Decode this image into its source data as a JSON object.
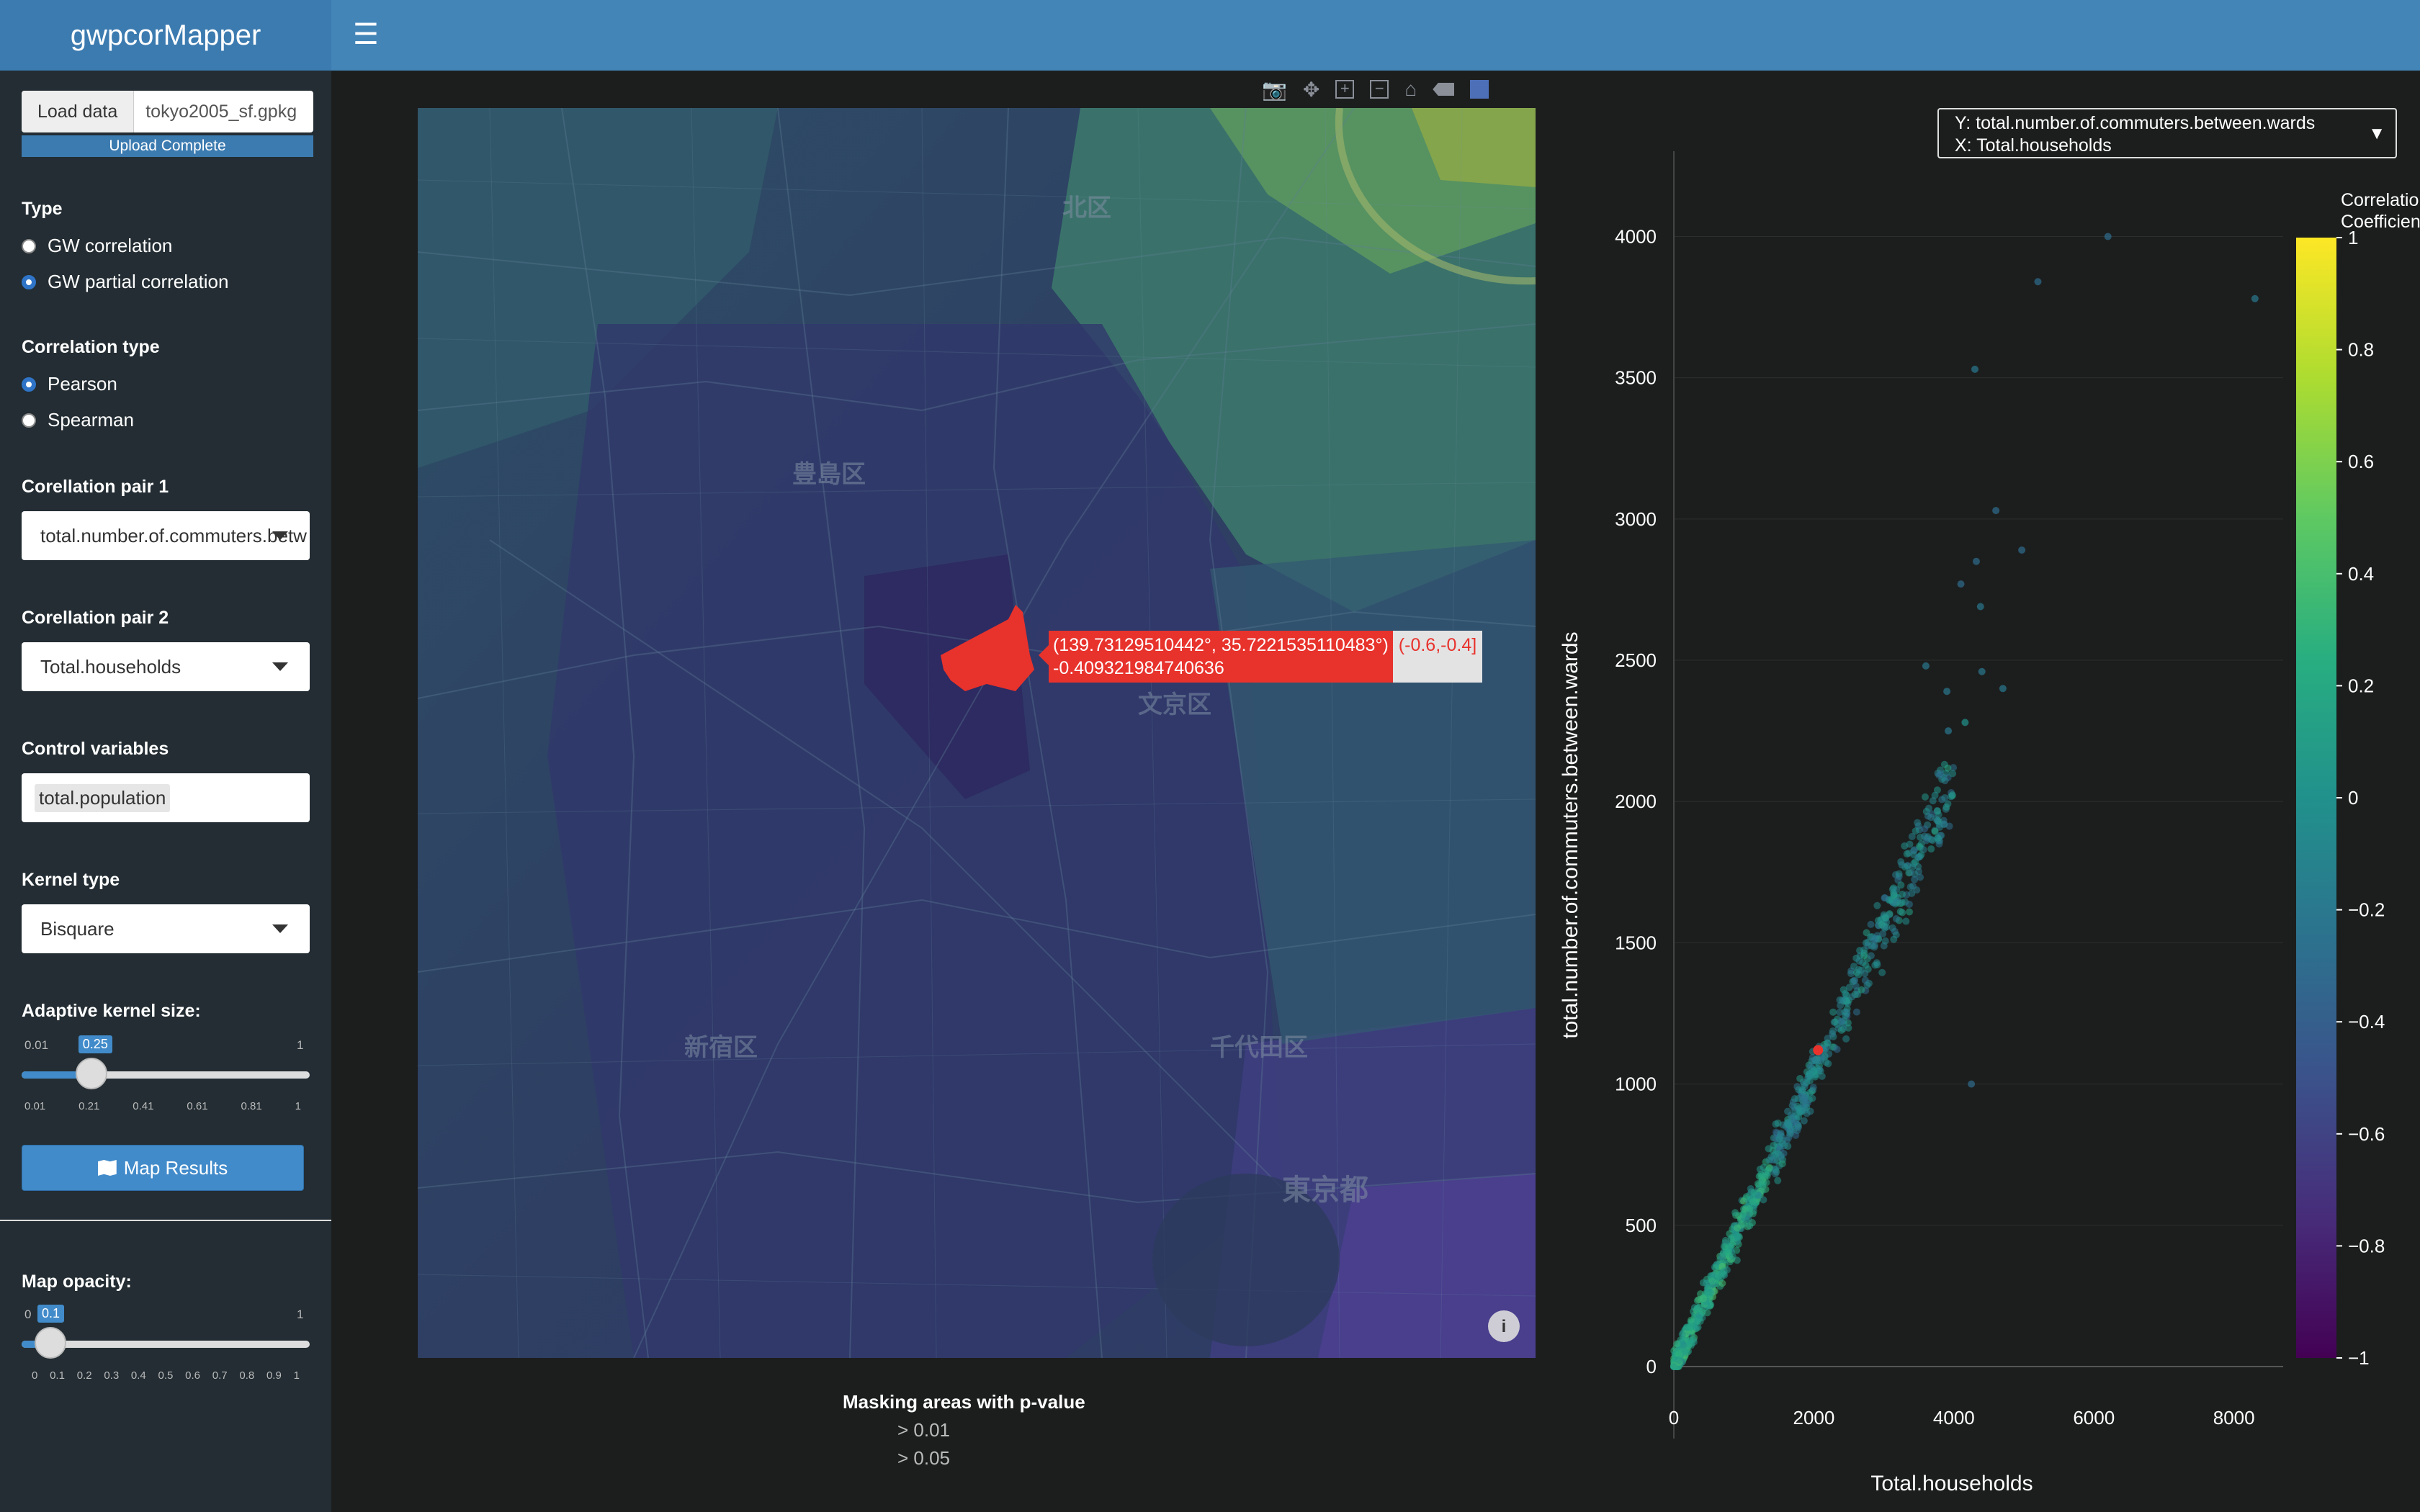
{
  "app": {
    "title": "gwpcorMapper"
  },
  "sidebar": {
    "load_data_button": "Load data",
    "file_name": "tokyo2005_sf.gpkg",
    "upload_status": "Upload Complete",
    "type": {
      "label": "Type",
      "options": [
        "GW correlation",
        "GW partial correlation"
      ],
      "selected": "GW partial correlation"
    },
    "correlation_type": {
      "label": "Correlation type",
      "options": [
        "Pearson",
        "Spearman"
      ],
      "selected": "Pearson"
    },
    "pair1": {
      "label": "Corellation pair 1",
      "value": "total.number.of.commuters.betw"
    },
    "pair2": {
      "label": "Corellation pair 2",
      "value": "Total.households"
    },
    "control_variables": {
      "label": "Control variables",
      "value": "total.population"
    },
    "kernel_type": {
      "label": "Kernel type",
      "value": "Bisquare"
    },
    "kernel_size": {
      "label": "Adaptive kernel size:",
      "min": "0.01",
      "max": "1",
      "value": "0.25",
      "fraction": 0.242,
      "ticks": [
        "0.01",
        "0.21",
        "0.41",
        "0.61",
        "0.81",
        "1"
      ]
    },
    "map_results_button": "Map Results",
    "map_opacity": {
      "label": "Map opacity:",
      "min": "0",
      "max": "1",
      "value": "0.1",
      "fraction": 0.1,
      "ticks": [
        "0",
        "0.1",
        "0.2",
        "0.3",
        "0.4",
        "0.5",
        "0.6",
        "0.7",
        "0.8",
        "0.9",
        "1"
      ]
    }
  },
  "map": {
    "place_labels": [
      "北区",
      "豊島区",
      "文京区",
      "新宿区",
      "千代田区",
      "東京都"
    ],
    "tooltip": {
      "coords": "(139.73129510442°, 35.7221535110483°)",
      "range": "(-0.6,-0.4]",
      "value": "-0.409321984740636"
    },
    "masking_legend": {
      "title": "Masking areas with p-value",
      "items": [
        "> 0.01",
        "> 0.05"
      ]
    },
    "toolbar_icons": [
      "camera-icon",
      "pan-icon",
      "zoom-in-icon",
      "zoom-out-icon",
      "home-icon",
      "hover-icon",
      "bar-chart-icon"
    ]
  },
  "scatter": {
    "axis_dropdown": {
      "y": "Y:  total.number.of.commuters.between.wards",
      "x": "X:  Total.households"
    },
    "colorbar": {
      "title_line1": "Correlation",
      "title_line2": "Coefficient",
      "ticks": [
        "1",
        "0.8",
        "0.6",
        "0.4",
        "0.2",
        "0",
        "−0.2",
        "−0.4",
        "−0.6",
        "−0.8",
        "−1"
      ]
    }
  },
  "chart_data": {
    "type": "scatter",
    "title": "",
    "xlabel": "Total.households",
    "ylabel": "total.number.of.commuters.between.wards",
    "xlim": [
      0,
      8600
    ],
    "ylim": [
      0,
      4200
    ],
    "x_ticks": [
      0,
      2000,
      4000,
      6000,
      8000
    ],
    "y_ticks": [
      0,
      500,
      1000,
      1500,
      2000,
      2500,
      3000,
      3500,
      4000
    ],
    "colorscale": "viridis",
    "color_range": [
      -1,
      1
    ],
    "highlighted_point": {
      "x": 2060,
      "y": 1120,
      "color": "#e8322c"
    },
    "outlier_points": [
      {
        "x": 6200,
        "y": 4000,
        "c": -0.3
      },
      {
        "x": 8300,
        "y": 3780,
        "c": -0.2
      },
      {
        "x": 5200,
        "y": 3840,
        "c": -0.3
      },
      {
        "x": 4300,
        "y": 3530,
        "c": -0.2
      },
      {
        "x": 4600,
        "y": 3030,
        "c": -0.3
      },
      {
        "x": 4970,
        "y": 2890,
        "c": -0.3
      },
      {
        "x": 4320,
        "y": 2850,
        "c": -0.3
      },
      {
        "x": 4100,
        "y": 2770,
        "c": -0.3
      },
      {
        "x": 4380,
        "y": 2690,
        "c": -0.2
      },
      {
        "x": 3600,
        "y": 2480,
        "c": -0.2
      },
      {
        "x": 4400,
        "y": 2460,
        "c": -0.2
      },
      {
        "x": 4700,
        "y": 2400,
        "c": -0.2
      },
      {
        "x": 3900,
        "y": 2390,
        "c": -0.2
      },
      {
        "x": 4160,
        "y": 2280,
        "c": 0.0
      },
      {
        "x": 3920,
        "y": 2250,
        "c": -0.2
      },
      {
        "x": 4250,
        "y": 1000,
        "c": -0.3
      }
    ],
    "cluster": {
      "x_range": [
        0,
        4000
      ],
      "slope": 0.52,
      "spread": 140,
      "count": 900,
      "color_mean": -0.1
    }
  }
}
